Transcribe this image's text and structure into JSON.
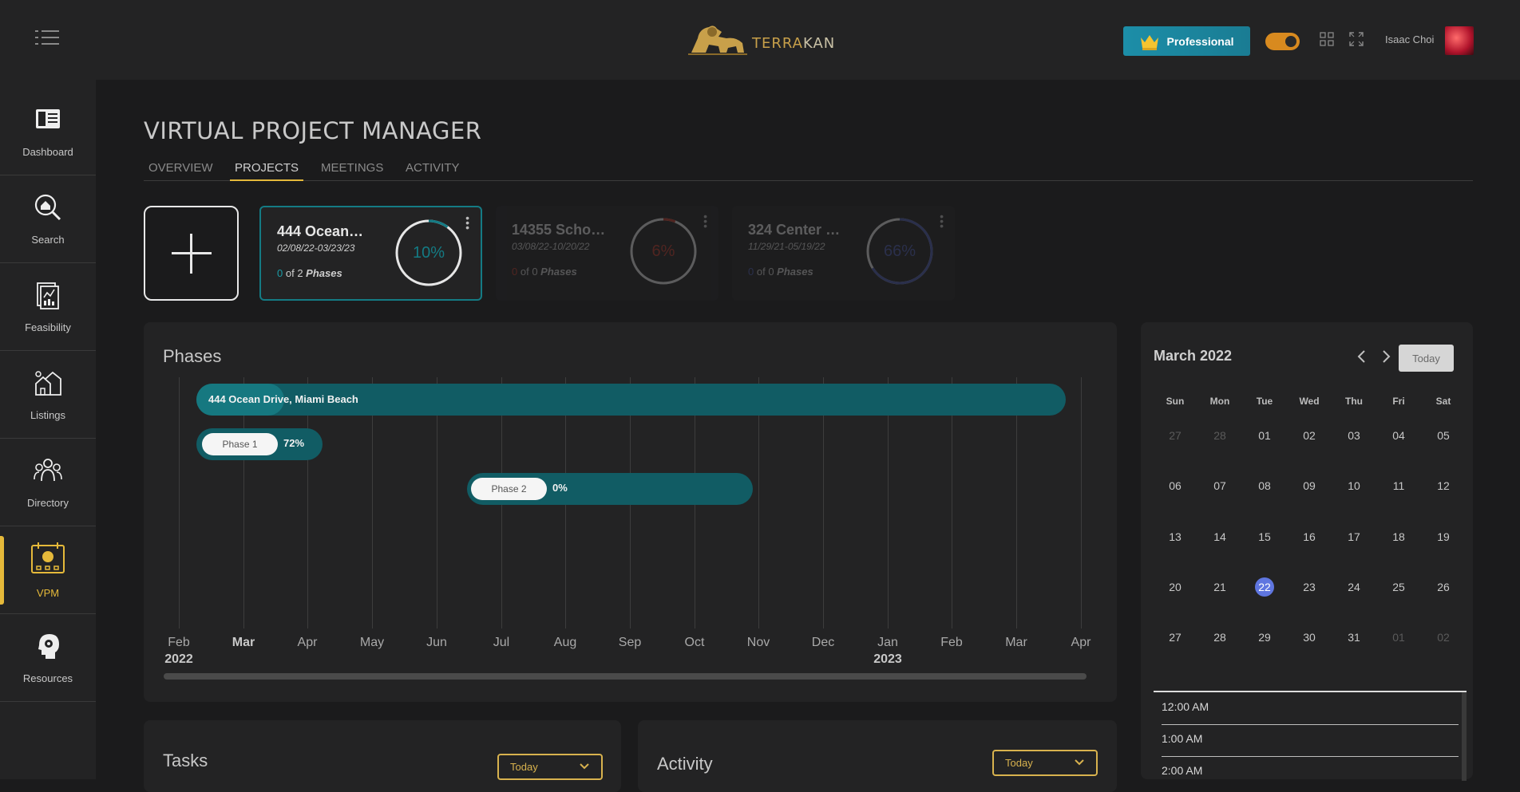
{
  "app": {
    "brand_prefix": "TERRA",
    "brand_suffix": "KAN",
    "plan_label": "Professional",
    "user_name": "Isaac Choi"
  },
  "sidebar": {
    "items": [
      {
        "label": "Dashboard",
        "icon": "dashboard-icon"
      },
      {
        "label": "Search",
        "icon": "home-search-icon"
      },
      {
        "label": "Feasibility",
        "icon": "report-icon"
      },
      {
        "label": "Listings",
        "icon": "houses-icon"
      },
      {
        "label": "Directory",
        "icon": "people-icon"
      },
      {
        "label": "VPM",
        "icon": "vpm-calendar-icon",
        "active": true
      },
      {
        "label": "Resources",
        "icon": "head-gear-icon"
      }
    ]
  },
  "page": {
    "title": "VIRTUAL PROJECT MANAGER",
    "tabs": [
      "OVERVIEW",
      "PROJECTS",
      "MEETINGS",
      "ACTIVITY"
    ],
    "active_tab": "PROJECTS"
  },
  "projects": [
    {
      "name": "444 Ocean…",
      "dates": "02/08/22-03/23/23",
      "done": "0",
      "of_total": "of 2",
      "phases_word": "Phases",
      "percent": "10%",
      "progress": 0.1,
      "ring_color": "#147b84",
      "active": true
    },
    {
      "name": "14355 Schoo…",
      "dates": "03/08/22-10/20/22",
      "done": "0",
      "of_total": "of 0",
      "phases_word": "Phases",
      "percent": "6%",
      "progress": 0.06,
      "ring_color": "#c0392b",
      "active": false
    },
    {
      "name": "324 Center S…",
      "dates": "11/29/21-05/19/22",
      "done": "0",
      "of_total": "of 0",
      "phases_word": "Phases",
      "percent": "66%",
      "progress": 0.66,
      "ring_color": "#4a5bb0",
      "active": false
    }
  ],
  "phases": {
    "title": "Phases",
    "project_bar": {
      "label": "444 Ocean Drive, Miami Beach",
      "progress": 0.1
    },
    "phase_bars": [
      {
        "label": "Phase 1",
        "percent": "72%"
      },
      {
        "label": "Phase 2",
        "percent": "0%"
      }
    ],
    "months": [
      "Feb",
      "Mar",
      "Apr",
      "May",
      "Jun",
      "Jul",
      "Aug",
      "Sep",
      "Oct",
      "Nov",
      "Dec",
      "Jan",
      "Feb",
      "Mar",
      "Apr"
    ],
    "years": [
      "2022",
      "2023"
    ]
  },
  "calendar": {
    "title": "March 2022",
    "today_label": "Today",
    "weekdays": [
      "Sun",
      "Mon",
      "Tue",
      "Wed",
      "Thu",
      "Fri",
      "Sat"
    ],
    "weeks": [
      [
        "27",
        "28",
        "01",
        "02",
        "03",
        "04",
        "05"
      ],
      [
        "06",
        "07",
        "08",
        "09",
        "10",
        "11",
        "12"
      ],
      [
        "13",
        "14",
        "15",
        "16",
        "17",
        "18",
        "19"
      ],
      [
        "20",
        "21",
        "22",
        "23",
        "24",
        "25",
        "26"
      ],
      [
        "27",
        "28",
        "29",
        "30",
        "31",
        "01",
        "02"
      ]
    ],
    "selected_day": "22",
    "times": [
      "12:00 AM",
      "1:00 AM",
      "2:00 AM"
    ]
  },
  "tasks": {
    "title": "Tasks",
    "filter": "Today"
  },
  "activity": {
    "title": "Activity",
    "filter": "Today"
  },
  "colors": {
    "accent": "#e5b93a",
    "teal": "#115c64",
    "teal_bright": "#147b84",
    "selected_day": "#5f76e0"
  }
}
